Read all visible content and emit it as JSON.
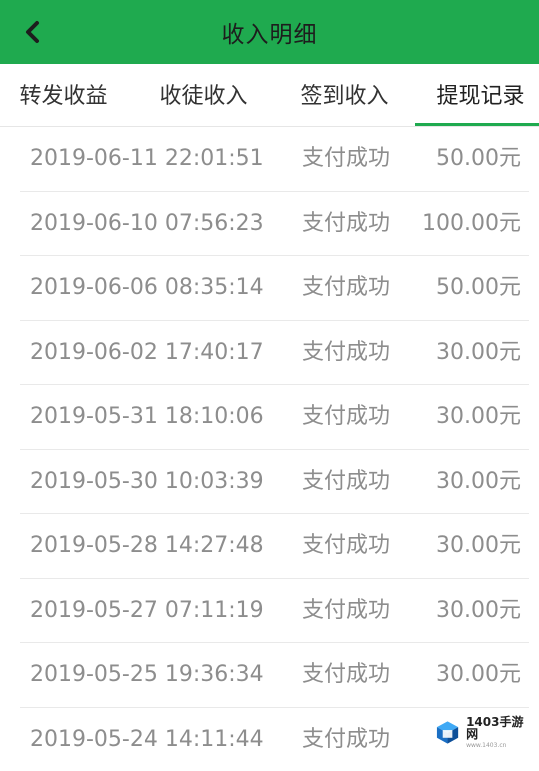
{
  "header": {
    "title": "收入明细",
    "back_icon": "chevron-left-icon"
  },
  "tabs": [
    {
      "label": "转发收益",
      "active": false
    },
    {
      "label": "收徒收入",
      "active": false
    },
    {
      "label": "签到收入",
      "active": false
    },
    {
      "label": "提现记录",
      "active": true
    }
  ],
  "records": [
    {
      "date": "2019-06-11 22:01:51",
      "status": "支付成功",
      "amount": "50.00元"
    },
    {
      "date": "2019-06-10 07:56:23",
      "status": "支付成功",
      "amount": "100.00元"
    },
    {
      "date": "2019-06-06 08:35:14",
      "status": "支付成功",
      "amount": "50.00元"
    },
    {
      "date": "2019-06-02 17:40:17",
      "status": "支付成功",
      "amount": "30.00元"
    },
    {
      "date": "2019-05-31 18:10:06",
      "status": "支付成功",
      "amount": "30.00元"
    },
    {
      "date": "2019-05-30 10:03:39",
      "status": "支付成功",
      "amount": "30.00元"
    },
    {
      "date": "2019-05-28 14:27:48",
      "status": "支付成功",
      "amount": "30.00元"
    },
    {
      "date": "2019-05-27 07:11:19",
      "status": "支付成功",
      "amount": "30.00元"
    },
    {
      "date": "2019-05-25 19:36:34",
      "status": "支付成功",
      "amount": "30.00元"
    },
    {
      "date": "2019-05-24 14:11:44",
      "status": "支付成功",
      "amount": ""
    }
  ],
  "watermark": {
    "main": "1403手游网",
    "sub": "www.1403.cn"
  },
  "colors": {
    "accent": "#1faa4f",
    "text_muted": "#8d8d8d"
  }
}
